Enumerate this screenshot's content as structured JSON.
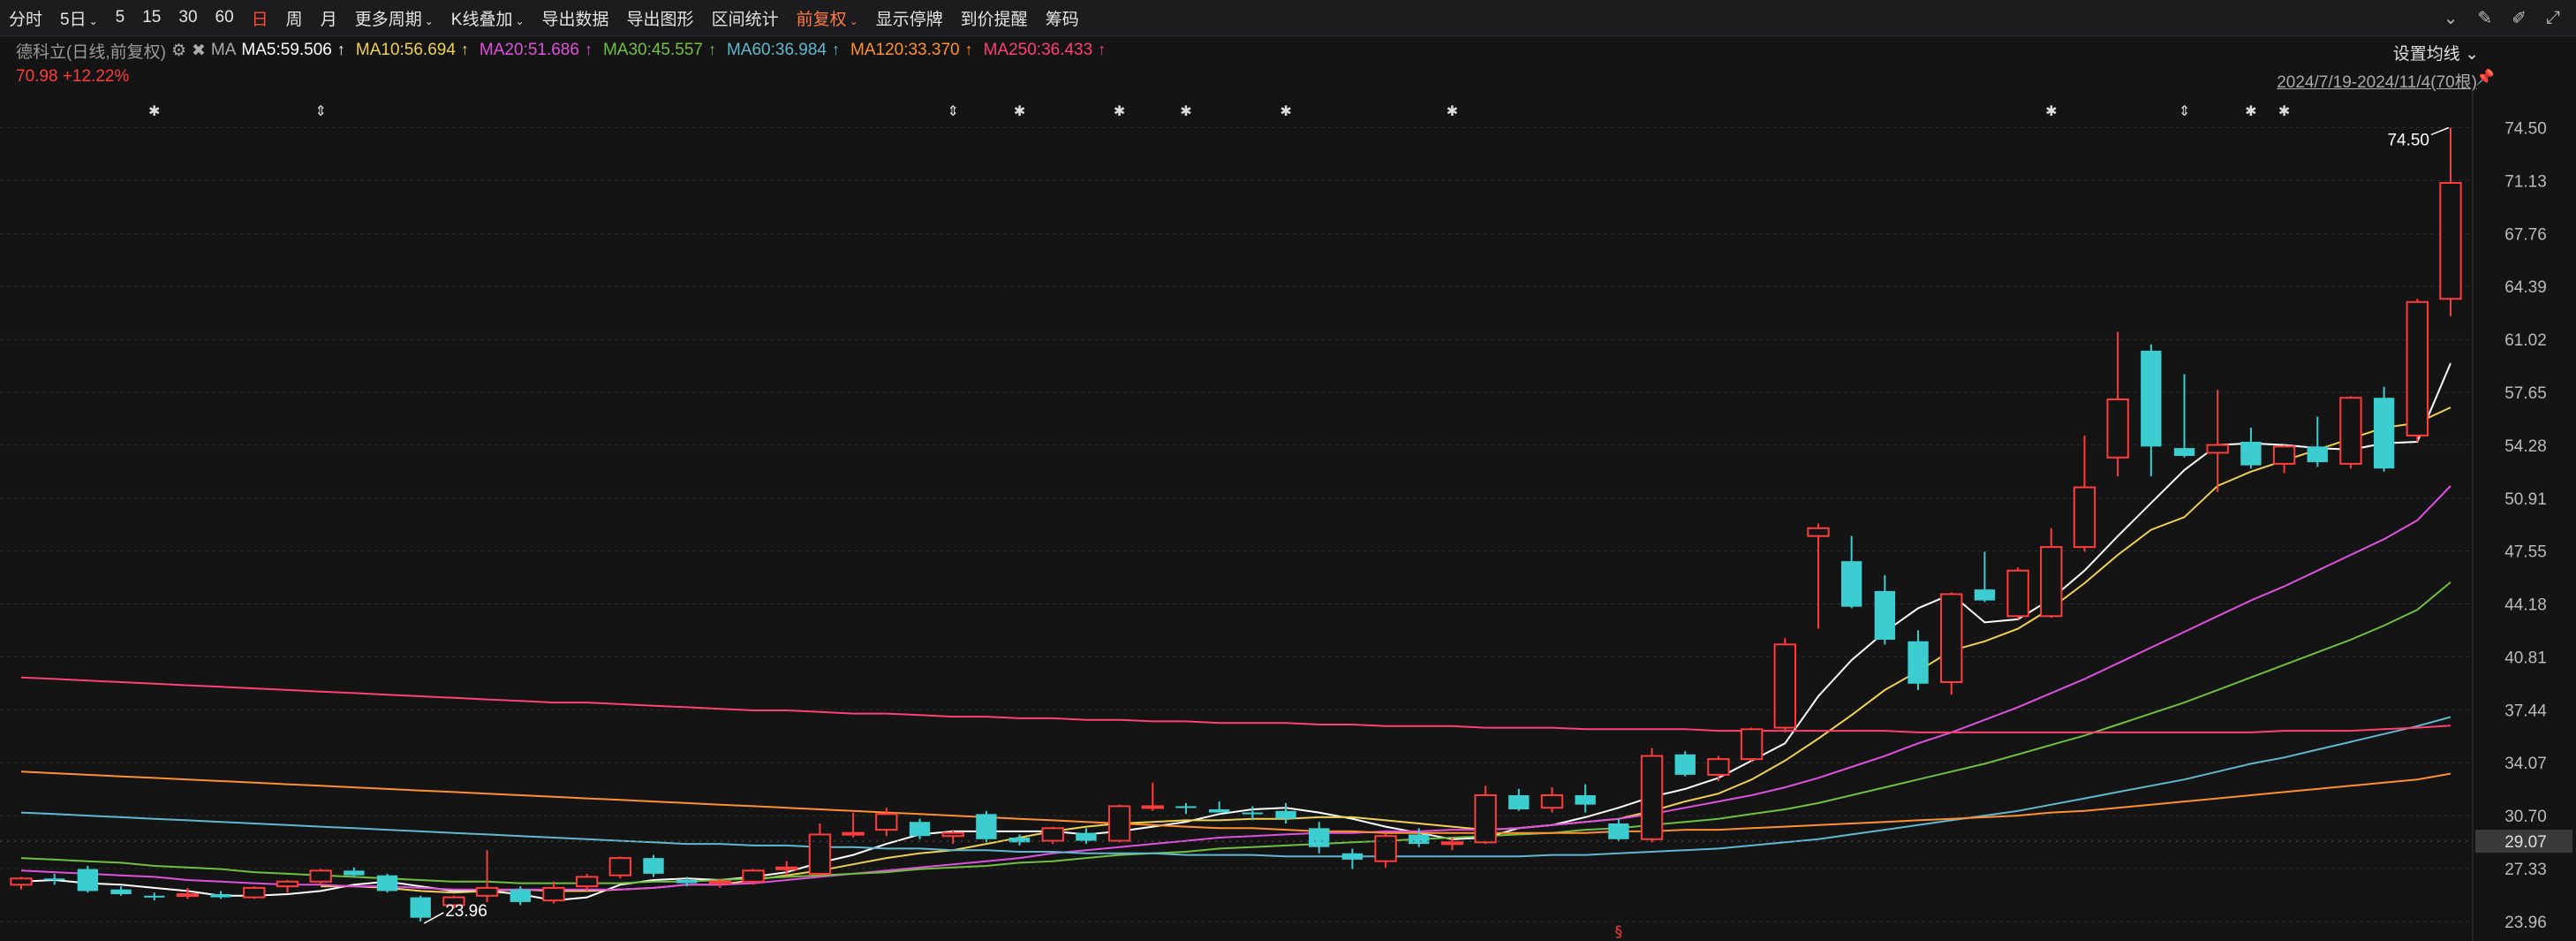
{
  "toolbar": {
    "items": [
      {
        "label": "分时",
        "active": false,
        "dropdown": false
      },
      {
        "label": "5日",
        "active": false,
        "dropdown": true
      },
      {
        "label": "5",
        "active": false,
        "dropdown": false
      },
      {
        "label": "15",
        "active": false,
        "dropdown": false
      },
      {
        "label": "30",
        "active": false,
        "dropdown": false
      },
      {
        "label": "60",
        "active": false,
        "dropdown": false
      },
      {
        "label": "日",
        "active": true,
        "dropdown": false
      },
      {
        "label": "周",
        "active": false,
        "dropdown": false
      },
      {
        "label": "月",
        "active": false,
        "dropdown": false
      },
      {
        "label": "更多周期",
        "active": false,
        "dropdown": true
      },
      {
        "label": "K线叠加",
        "active": false,
        "dropdown": true
      },
      {
        "label": "导出数据",
        "active": false,
        "dropdown": false
      },
      {
        "label": "导出图形",
        "active": false,
        "dropdown": false
      },
      {
        "label": "区间统计",
        "active": false,
        "dropdown": false
      },
      {
        "label": "前复权",
        "active": false,
        "accent": true,
        "dropdown": true
      },
      {
        "label": "显示停牌",
        "active": false,
        "dropdown": false
      },
      {
        "label": "到价提醒",
        "active": false,
        "dropdown": false
      },
      {
        "label": "筹码",
        "active": false,
        "dropdown": false
      }
    ],
    "right_icons": [
      "chevron-circle-icon",
      "brush-icon",
      "pencil-icon",
      "fullscreen-icon"
    ]
  },
  "info": {
    "stock_label": "德科立(日线,前复权)",
    "ma_label": "MA",
    "ma": [
      {
        "label": "MA5:59.506",
        "color": "#ffffff"
      },
      {
        "label": "MA10:56.694",
        "color": "#f0d050"
      },
      {
        "label": "MA20:51.686",
        "color": "#e050e0"
      },
      {
        "label": "MA30:45.557",
        "color": "#70c040"
      },
      {
        "label": "MA60:36.984",
        "color": "#60b8d0"
      },
      {
        "label": "MA120:33.370",
        "color": "#ff9030"
      },
      {
        "label": "MA250:36.433",
        "color": "#ff4070"
      }
    ],
    "price": "70.98",
    "change": "+12.22%",
    "set_ma": "设置均线",
    "range": "2024/7/19-2024/11/4(70根)"
  },
  "chart_data": {
    "type": "candlestick",
    "ylim": [
      23.0,
      77.0
    ],
    "y_ticks": [
      "74.50",
      "71.13",
      "67.76",
      "64.39",
      "61.02",
      "57.65",
      "54.28",
      "50.91",
      "47.55",
      "44.18",
      "40.81",
      "37.44",
      "34.07",
      "30.70",
      "27.33",
      "23.96"
    ],
    "current_price_tag": "29.07",
    "high_label": "74.50",
    "low_label": "23.96",
    "candles": [
      [
        26.3,
        26.8,
        26.0,
        26.7
      ],
      [
        26.7,
        27.0,
        26.3,
        26.6
      ],
      [
        27.3,
        27.5,
        25.8,
        25.9
      ],
      [
        26.0,
        26.2,
        25.6,
        25.7
      ],
      [
        25.6,
        25.8,
        25.3,
        25.5
      ],
      [
        25.6,
        26.1,
        25.4,
        25.7
      ],
      [
        25.7,
        25.9,
        25.4,
        25.5
      ],
      [
        25.5,
        26.2,
        25.4,
        26.1
      ],
      [
        26.2,
        26.6,
        25.8,
        26.5
      ],
      [
        26.5,
        27.3,
        26.3,
        27.2
      ],
      [
        27.2,
        27.4,
        26.8,
        26.9
      ],
      [
        26.9,
        27.0,
        25.8,
        25.9
      ],
      [
        25.5,
        25.6,
        23.96,
        24.2
      ],
      [
        25.0,
        25.6,
        24.8,
        25.5
      ],
      [
        25.6,
        28.5,
        25.2,
        26.1
      ],
      [
        26.0,
        26.2,
        25.0,
        25.2
      ],
      [
        25.3,
        26.5,
        25.1,
        26.1
      ],
      [
        26.2,
        27.0,
        25.9,
        26.8
      ],
      [
        26.9,
        28.1,
        26.7,
        28.0
      ],
      [
        28.0,
        28.2,
        26.8,
        27.0
      ],
      [
        26.6,
        26.8,
        26.2,
        26.4
      ],
      [
        26.4,
        26.7,
        26.1,
        26.5
      ],
      [
        26.5,
        27.3,
        26.3,
        27.2
      ],
      [
        27.3,
        27.8,
        26.9,
        27.4
      ],
      [
        27.0,
        30.2,
        26.9,
        29.5
      ],
      [
        29.5,
        30.9,
        29.3,
        29.6
      ],
      [
        29.8,
        31.2,
        29.4,
        30.8
      ],
      [
        30.3,
        30.5,
        29.2,
        29.4
      ],
      [
        29.4,
        29.8,
        28.9,
        29.6
      ],
      [
        30.8,
        31.0,
        29.0,
        29.2
      ],
      [
        29.3,
        29.5,
        28.8,
        29.0
      ],
      [
        29.1,
        30.0,
        28.9,
        29.9
      ],
      [
        29.6,
        29.9,
        28.9,
        29.1
      ],
      [
        29.1,
        31.4,
        29.0,
        31.3
      ],
      [
        31.2,
        32.8,
        31.0,
        31.3
      ],
      [
        31.3,
        31.5,
        30.8,
        31.2
      ],
      [
        31.1,
        31.6,
        30.9,
        30.9
      ],
      [
        30.9,
        31.3,
        30.4,
        30.8
      ],
      [
        31.0,
        31.5,
        30.2,
        30.5
      ],
      [
        29.9,
        30.3,
        28.3,
        28.7
      ],
      [
        28.3,
        28.6,
        27.3,
        27.9
      ],
      [
        27.8,
        29.6,
        27.4,
        29.4
      ],
      [
        29.5,
        29.9,
        28.7,
        28.9
      ],
      [
        29.0,
        29.3,
        28.5,
        29.0
      ],
      [
        29.0,
        32.6,
        28.9,
        32.0
      ],
      [
        32.0,
        32.4,
        31.0,
        31.1
      ],
      [
        31.2,
        32.5,
        30.9,
        32.0
      ],
      [
        32.0,
        32.7,
        30.9,
        31.4
      ],
      [
        30.2,
        30.5,
        29.1,
        29.2
      ],
      [
        29.2,
        35.0,
        29.0,
        34.5
      ],
      [
        34.6,
        34.8,
        33.2,
        33.3
      ],
      [
        33.3,
        34.5,
        32.9,
        34.3
      ],
      [
        34.3,
        36.3,
        34.1,
        36.2
      ],
      [
        36.3,
        42.0,
        36.0,
        41.6
      ],
      [
        48.5,
        49.3,
        42.6,
        49.0
      ],
      [
        46.9,
        48.5,
        43.9,
        44.0
      ],
      [
        45.0,
        46.0,
        41.6,
        41.9
      ],
      [
        41.8,
        42.5,
        38.7,
        39.1
      ],
      [
        39.2,
        44.9,
        38.4,
        44.8
      ],
      [
        45.1,
        47.5,
        44.3,
        44.4
      ],
      [
        43.4,
        46.5,
        43.2,
        46.3
      ],
      [
        43.4,
        49.0,
        43.3,
        47.8
      ],
      [
        47.8,
        54.9,
        47.5,
        51.6
      ],
      [
        53.5,
        61.5,
        52.3,
        57.2
      ],
      [
        60.3,
        60.7,
        52.3,
        54.2
      ],
      [
        54.1,
        58.8,
        53.5,
        53.6
      ],
      [
        53.8,
        57.8,
        51.3,
        54.3
      ],
      [
        54.5,
        55.4,
        52.8,
        53.0
      ],
      [
        53.1,
        54.3,
        52.5,
        54.2
      ],
      [
        54.2,
        56.1,
        52.9,
        53.2
      ],
      [
        53.1,
        57.4,
        52.8,
        57.3
      ],
      [
        57.3,
        58.0,
        52.6,
        52.8
      ],
      [
        54.9,
        63.6,
        54.5,
        63.4
      ],
      [
        63.6,
        74.5,
        62.5,
        70.98
      ]
    ],
    "ma": {
      "MA5": [
        26.5,
        26.6,
        26.4,
        26.3,
        26.1,
        25.9,
        25.6,
        25.6,
        25.7,
        25.9,
        26.3,
        26.5,
        26.2,
        25.9,
        25.9,
        25.7,
        25.3,
        25.5,
        26.3,
        26.6,
        26.7,
        26.6,
        26.8,
        27.1,
        27.7,
        28.2,
        28.9,
        29.5,
        29.7,
        29.7,
        29.7,
        29.7,
        29.5,
        29.7,
        30.0,
        30.3,
        30.8,
        31.1,
        31.2,
        30.9,
        30.5,
        30.0,
        29.6,
        29.2,
        29.3,
        29.9,
        30.1,
        30.6,
        31.2,
        31.9,
        32.4,
        33.1,
        34.2,
        35.3,
        38.3,
        40.6,
        42.4,
        43.9,
        44.8,
        43.0,
        43.2,
        44.5,
        46.3,
        48.5,
        50.6,
        52.7,
        54.3,
        54.4,
        54.3,
        54.1,
        54.0,
        54.4,
        54.5,
        59.5
      ],
      "MA10": [
        null,
        null,
        null,
        null,
        null,
        null,
        null,
        null,
        null,
        26.2,
        26.2,
        26.1,
        25.9,
        25.8,
        25.9,
        26.0,
        25.9,
        25.9,
        26.0,
        26.1,
        26.3,
        26.3,
        26.6,
        26.9,
        27.2,
        27.6,
        28.0,
        28.3,
        28.5,
        28.9,
        29.3,
        29.7,
        30.0,
        30.2,
        30.3,
        30.4,
        30.4,
        30.5,
        30.5,
        30.6,
        30.6,
        30.4,
        30.2,
        30.0,
        29.8,
        29.9,
        30.1,
        30.3,
        30.5,
        31.0,
        31.6,
        32.1,
        33.0,
        34.2,
        35.6,
        37.1,
        38.7,
        39.9,
        41.2,
        41.8,
        42.6,
        43.9,
        45.5,
        47.3,
        48.9,
        49.7,
        51.7,
        52.6,
        53.3,
        54.0,
        54.7,
        55.4,
        55.7,
        56.69
      ],
      "MA20": [
        27.2,
        27.1,
        27.0,
        26.9,
        26.8,
        26.6,
        26.5,
        26.4,
        26.3,
        26.3,
        26.2,
        26.2,
        26.1,
        26.0,
        26.0,
        26.0,
        26.0,
        26.0,
        26.0,
        26.1,
        26.3,
        26.3,
        26.4,
        26.6,
        26.8,
        27.0,
        27.2,
        27.4,
        27.6,
        27.8,
        28.0,
        28.3,
        28.5,
        28.7,
        28.9,
        29.1,
        29.3,
        29.4,
        29.5,
        29.6,
        29.6,
        29.7,
        29.7,
        29.8,
        29.8,
        29.9,
        30.1,
        30.3,
        30.5,
        30.8,
        31.2,
        31.6,
        32.0,
        32.5,
        33.1,
        33.8,
        34.5,
        35.3,
        36.0,
        36.8,
        37.6,
        38.5,
        39.4,
        40.4,
        41.4,
        42.4,
        43.4,
        44.4,
        45.3,
        46.3,
        47.3,
        48.3,
        49.5,
        51.69
      ],
      "MA30": [
        28.0,
        27.9,
        27.8,
        27.7,
        27.5,
        27.4,
        27.3,
        27.1,
        27.0,
        26.9,
        26.8,
        26.7,
        26.6,
        26.5,
        26.5,
        26.4,
        26.4,
        26.4,
        26.4,
        26.5,
        26.5,
        26.6,
        26.7,
        26.8,
        26.9,
        27.0,
        27.1,
        27.3,
        27.4,
        27.5,
        27.7,
        27.8,
        28.0,
        28.2,
        28.3,
        28.4,
        28.6,
        28.7,
        28.8,
        28.9,
        29.0,
        29.1,
        29.2,
        29.3,
        29.4,
        29.5,
        29.6,
        29.8,
        29.9,
        30.1,
        30.3,
        30.5,
        30.8,
        31.1,
        31.5,
        32.0,
        32.5,
        33.0,
        33.5,
        34.0,
        34.6,
        35.2,
        35.8,
        36.5,
        37.2,
        37.9,
        38.7,
        39.5,
        40.3,
        41.1,
        41.9,
        42.8,
        43.8,
        45.56
      ],
      "MA60": [
        30.9,
        30.8,
        30.7,
        30.6,
        30.5,
        30.4,
        30.3,
        30.2,
        30.1,
        30.0,
        29.9,
        29.8,
        29.7,
        29.6,
        29.5,
        29.4,
        29.3,
        29.2,
        29.1,
        29.0,
        28.9,
        28.9,
        28.8,
        28.8,
        28.7,
        28.7,
        28.6,
        28.6,
        28.5,
        28.5,
        28.4,
        28.4,
        28.3,
        28.3,
        28.3,
        28.2,
        28.2,
        28.2,
        28.1,
        28.1,
        28.1,
        28.1,
        28.1,
        28.1,
        28.1,
        28.1,
        28.2,
        28.2,
        28.3,
        28.4,
        28.5,
        28.6,
        28.8,
        29.0,
        29.2,
        29.5,
        29.8,
        30.1,
        30.4,
        30.7,
        31.0,
        31.4,
        31.8,
        32.2,
        32.6,
        33.0,
        33.5,
        34.0,
        34.4,
        34.9,
        35.4,
        35.9,
        36.4,
        36.98
      ],
      "MA120": [
        33.5,
        33.4,
        33.3,
        33.2,
        33.1,
        33.0,
        32.9,
        32.8,
        32.7,
        32.6,
        32.5,
        32.4,
        32.3,
        32.2,
        32.1,
        32.0,
        31.9,
        31.8,
        31.7,
        31.6,
        31.5,
        31.4,
        31.3,
        31.2,
        31.1,
        31.0,
        30.9,
        30.8,
        30.7,
        30.6,
        30.5,
        30.4,
        30.3,
        30.2,
        30.1,
        30.0,
        29.9,
        29.9,
        29.8,
        29.7,
        29.7,
        29.6,
        29.6,
        29.6,
        29.6,
        29.6,
        29.6,
        29.6,
        29.7,
        29.7,
        29.8,
        29.8,
        29.9,
        30.0,
        30.1,
        30.2,
        30.3,
        30.4,
        30.5,
        30.6,
        30.7,
        30.9,
        31.0,
        31.2,
        31.4,
        31.6,
        31.8,
        32.0,
        32.2,
        32.4,
        32.6,
        32.8,
        33.0,
        33.37
      ],
      "MA250": [
        39.5,
        39.4,
        39.3,
        39.2,
        39.1,
        39.0,
        38.9,
        38.8,
        38.7,
        38.6,
        38.5,
        38.4,
        38.3,
        38.2,
        38.1,
        38.0,
        37.9,
        37.9,
        37.8,
        37.7,
        37.6,
        37.5,
        37.4,
        37.4,
        37.3,
        37.2,
        37.2,
        37.1,
        37.0,
        37.0,
        36.9,
        36.9,
        36.8,
        36.8,
        36.7,
        36.7,
        36.6,
        36.6,
        36.6,
        36.5,
        36.5,
        36.4,
        36.4,
        36.4,
        36.3,
        36.3,
        36.3,
        36.2,
        36.2,
        36.2,
        36.2,
        36.1,
        36.1,
        36.1,
        36.1,
        36.1,
        36.1,
        36.0,
        36.0,
        36.0,
        36.0,
        36.0,
        36.0,
        36.0,
        36.0,
        36.0,
        36.0,
        36.0,
        36.1,
        36.1,
        36.1,
        36.2,
        36.3,
        36.43
      ]
    }
  },
  "colors": {
    "up": "#ff3b3b",
    "down": "#3ccdd0",
    "grid": "#2c2c2c",
    "bg": "#141414"
  }
}
